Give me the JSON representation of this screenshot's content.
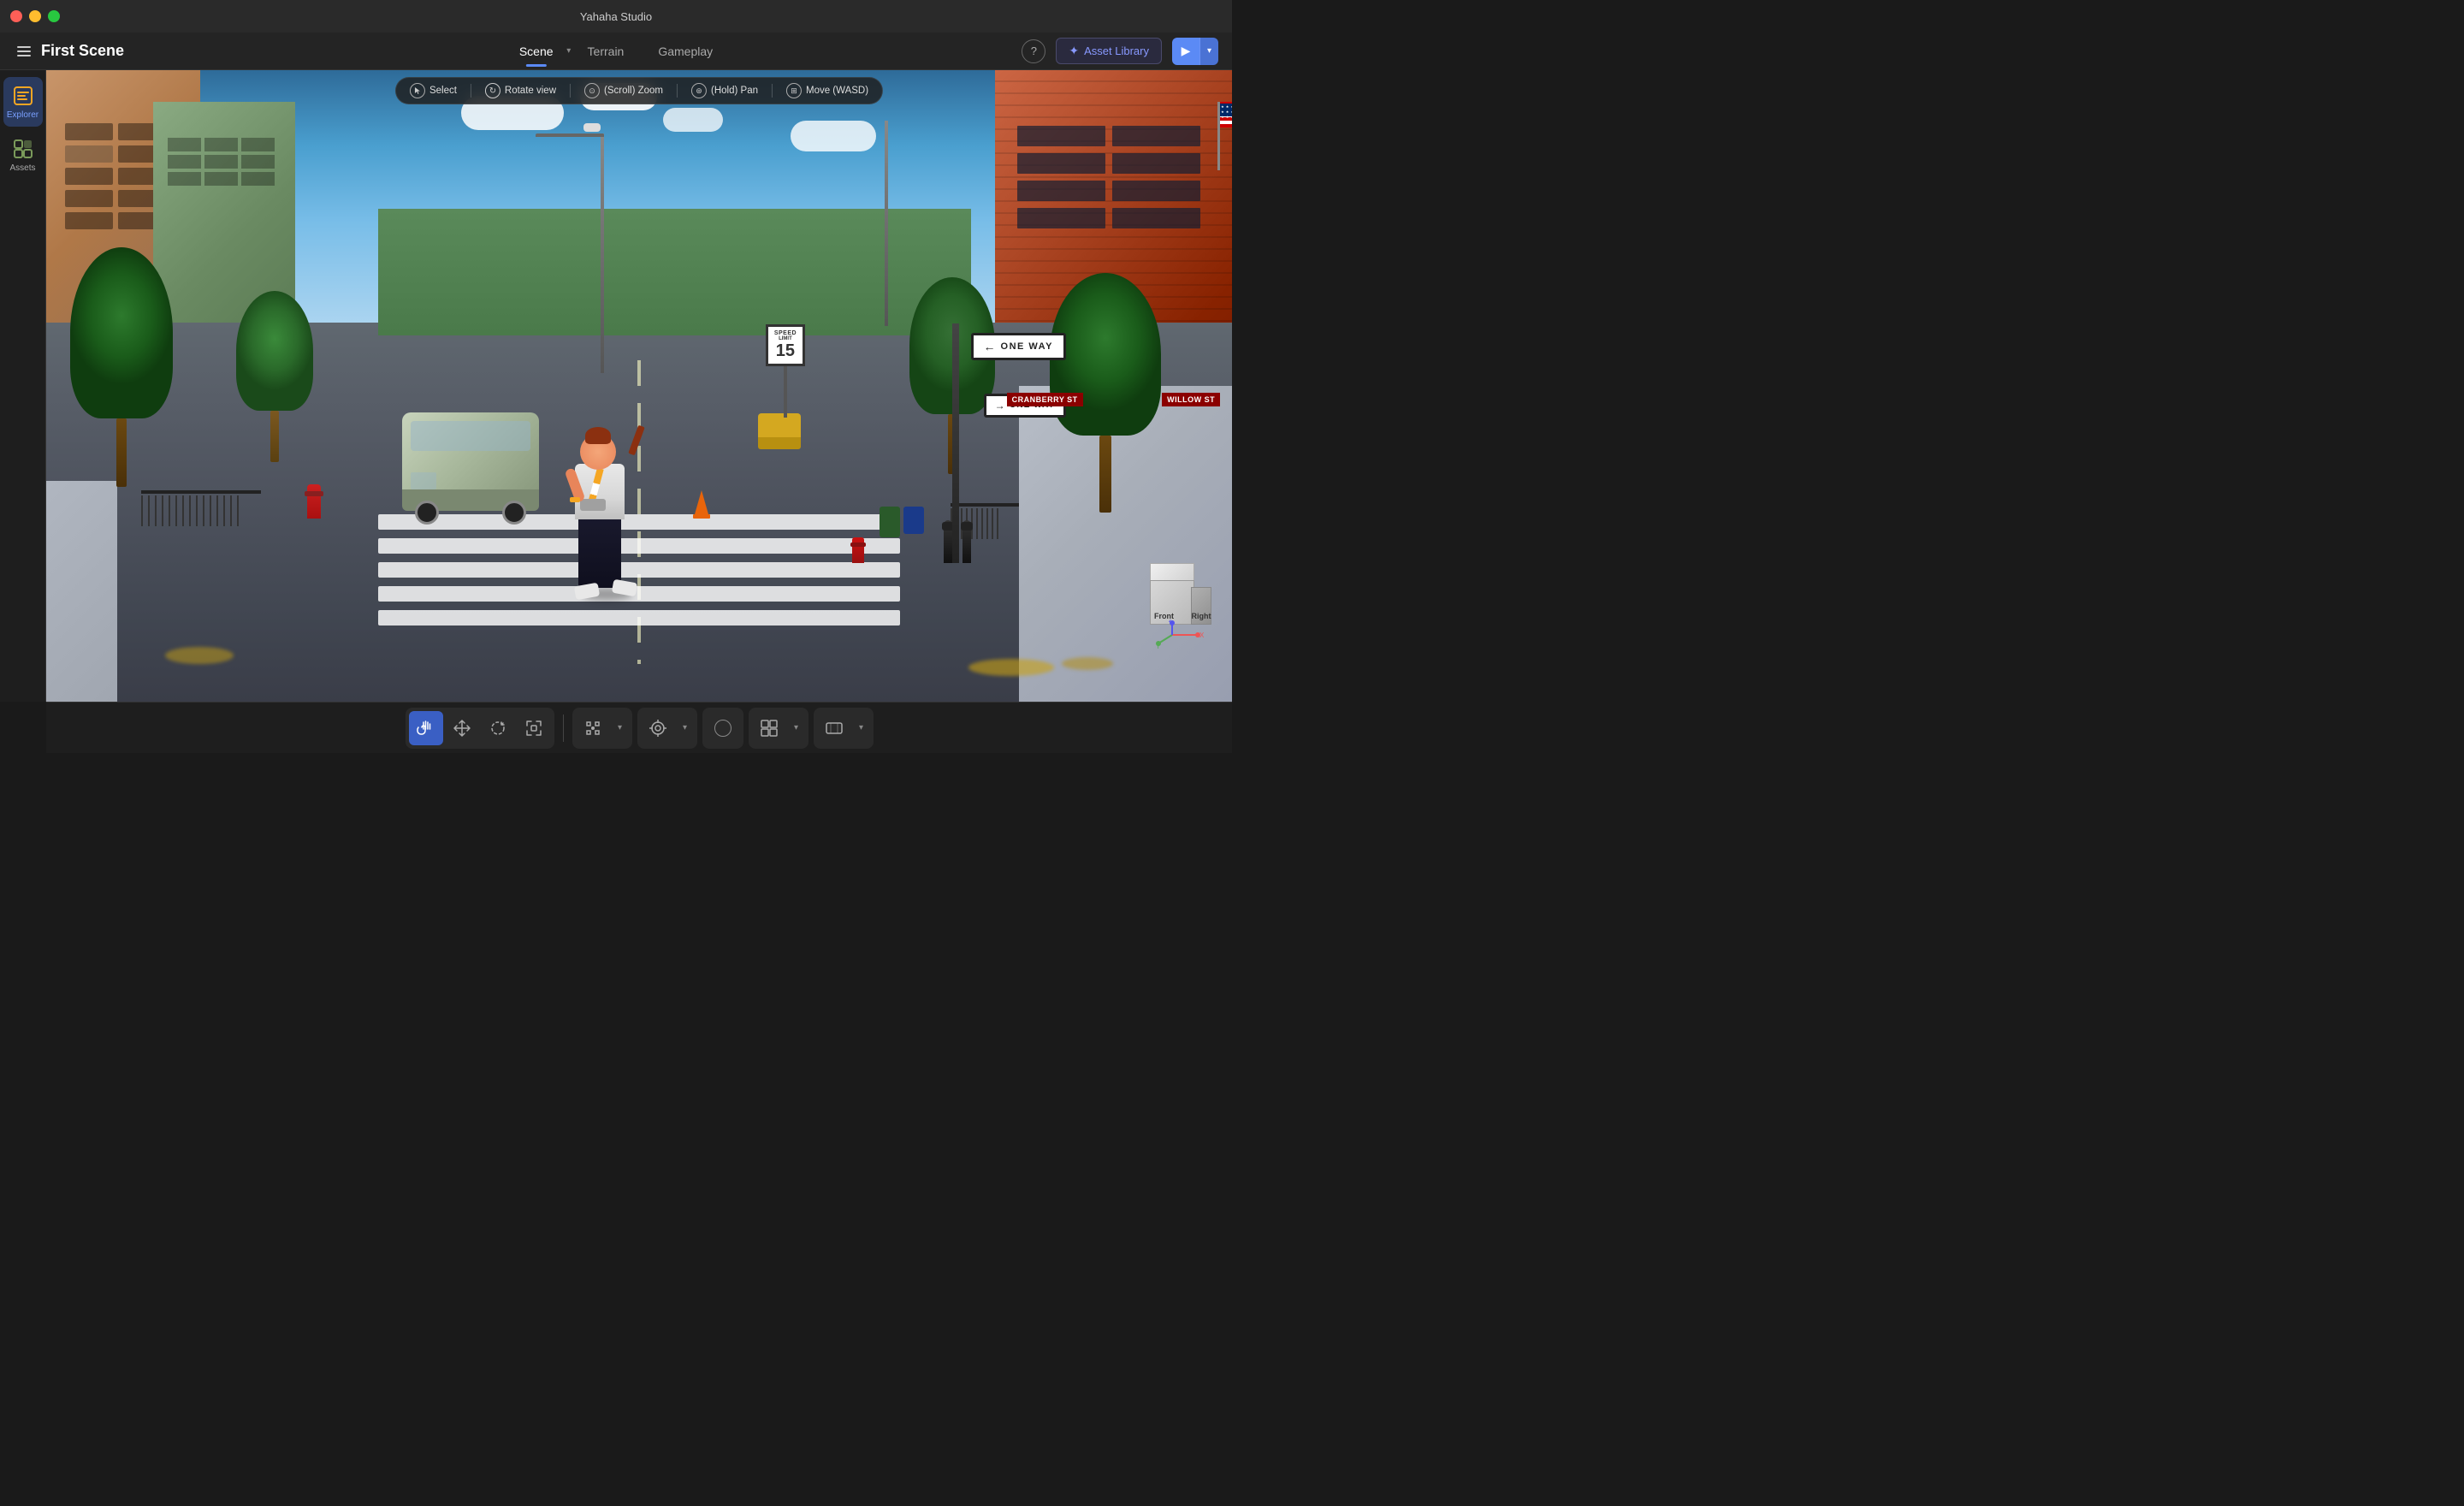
{
  "window": {
    "title": "Yahaha Studio",
    "scene_name": "First Scene"
  },
  "traffic_lights": {
    "red_label": "close",
    "yellow_label": "minimize",
    "green_label": "maximize"
  },
  "menu_bar": {
    "scene_tab": "Scene",
    "terrain_tab": "Terrain",
    "gameplay_tab": "Gameplay",
    "help_label": "?",
    "asset_library_label": "Asset Library",
    "play_label": "▶"
  },
  "sidebar": {
    "explorer_label": "Explorer",
    "assets_label": "Assets"
  },
  "viewport_toolbar": {
    "select_label": "Select",
    "rotate_label": "Rotate view",
    "zoom_label": "(Scroll) Zoom",
    "pan_label": "(Hold) Pan",
    "move_label": "Move (WASD)"
  },
  "scene": {
    "one_way_text": "ONE WAY",
    "one_way_text_2": "ONE WAY",
    "cranberry_st": "CRANBERRY ST",
    "willow_st": "WILLOW ST",
    "speed_limit_label": "SPEED",
    "speed_limit_sublabel": "LIMIT",
    "speed_number": "15"
  },
  "gizmo": {
    "front_label": "Front",
    "right_label": "Right"
  },
  "toolbar": {
    "tools": [
      {
        "name": "hand",
        "icon": "✋",
        "active": true
      },
      {
        "name": "move",
        "icon": "✥",
        "active": false
      },
      {
        "name": "rotate",
        "icon": "↻",
        "active": false
      },
      {
        "name": "scale",
        "icon": "⤡",
        "active": false
      },
      {
        "name": "transform",
        "icon": "⊕",
        "active": false
      }
    ]
  }
}
